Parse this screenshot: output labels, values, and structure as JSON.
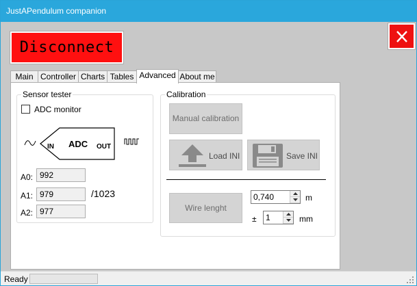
{
  "window": {
    "title": "JustAPendulum companion"
  },
  "header": {
    "disconnect_label": "Disconnect"
  },
  "tabs": [
    {
      "label": "Main"
    },
    {
      "label": "Controller"
    },
    {
      "label": "Charts"
    },
    {
      "label": "Tables"
    },
    {
      "label": "Advanced",
      "active": true
    },
    {
      "label": "About me"
    }
  ],
  "sensor_tester": {
    "title": "Sensor tester",
    "adc_monitor_label": "ADC monitor",
    "adc_monitor_checked": false,
    "diagram": {
      "in_label": "IN",
      "adc_label": "ADC",
      "out_label": "OUT"
    },
    "channels": [
      {
        "label": "A0:",
        "value": "992"
      },
      {
        "label": "A1:",
        "value": "979"
      },
      {
        "label": "A2:",
        "value": "977"
      }
    ],
    "max_label": "/1023"
  },
  "calibration": {
    "title": "Calibration",
    "manual_button": "Manual calibration",
    "load_button": "Load INI",
    "save_button": "Save INI",
    "wire_button": "Wire lenght",
    "wire_value": "0,740",
    "wire_unit": "m",
    "tolerance_symbol": "±",
    "tolerance_value": "1",
    "tolerance_unit": "mm"
  },
  "status": {
    "text": "Ready"
  },
  "colors": {
    "titlebar": "#2aa7dc",
    "disconnect": "#ff1010",
    "close": "#ee1111"
  }
}
